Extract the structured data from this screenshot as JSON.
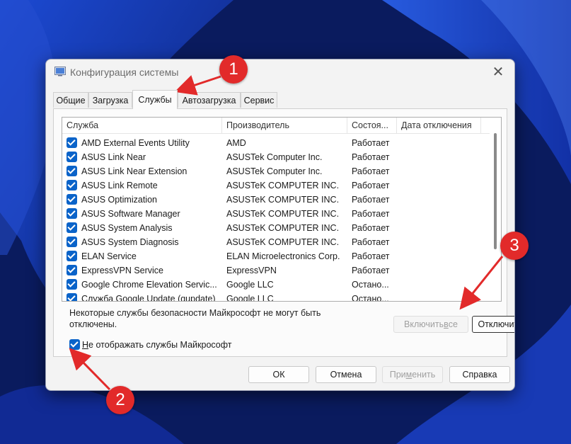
{
  "window": {
    "title": "Конфигурация системы",
    "close": "✕"
  },
  "tabs": [
    {
      "label": "Общие",
      "active": false
    },
    {
      "label": "Загрузка",
      "active": false
    },
    {
      "label": "Службы",
      "active": true
    },
    {
      "label": "Автозагрузка",
      "active": false
    },
    {
      "label": "Сервис",
      "active": false
    }
  ],
  "services_table": {
    "columns": [
      "Служба",
      "Производитель",
      "Состоя...",
      "Дата отключения"
    ],
    "rows": [
      {
        "checked": true,
        "service": "AMD External Events Utility",
        "manufacturer": "AMD",
        "status": "Работает",
        "disabled_date": ""
      },
      {
        "checked": true,
        "service": "ASUS Link Near",
        "manufacturer": "ASUSTek Computer Inc.",
        "status": "Работает",
        "disabled_date": ""
      },
      {
        "checked": true,
        "service": "ASUS Link Near Extension",
        "manufacturer": "ASUSTek Computer Inc.",
        "status": "Работает",
        "disabled_date": ""
      },
      {
        "checked": true,
        "service": "ASUS Link Remote",
        "manufacturer": "ASUSTeK COMPUTER INC.",
        "status": "Работает",
        "disabled_date": ""
      },
      {
        "checked": true,
        "service": "ASUS Optimization",
        "manufacturer": "ASUSTeK COMPUTER INC.",
        "status": "Работает",
        "disabled_date": ""
      },
      {
        "checked": true,
        "service": "ASUS Software Manager",
        "manufacturer": "ASUSTeK COMPUTER INC.",
        "status": "Работает",
        "disabled_date": ""
      },
      {
        "checked": true,
        "service": "ASUS System Analysis",
        "manufacturer": "ASUSTeK COMPUTER INC.",
        "status": "Работает",
        "disabled_date": ""
      },
      {
        "checked": true,
        "service": "ASUS System Diagnosis",
        "manufacturer": "ASUSTeK COMPUTER INC.",
        "status": "Работает",
        "disabled_date": ""
      },
      {
        "checked": true,
        "service": "ELAN Service",
        "manufacturer": "ELAN Microelectronics Corp.",
        "status": "Работает",
        "disabled_date": ""
      },
      {
        "checked": true,
        "service": "ExpressVPN Service",
        "manufacturer": "ExpressVPN",
        "status": "Работает",
        "disabled_date": ""
      },
      {
        "checked": true,
        "service": "Google Chrome Elevation Servic...",
        "manufacturer": "Google LLC",
        "status": "Остано...",
        "disabled_date": ""
      },
      {
        "checked": true,
        "service": "Служба Google Update (gupdate)",
        "manufacturer": "Google LLC",
        "status": "Остано...",
        "disabled_date": ""
      }
    ]
  },
  "note": {
    "line1": "Некоторые службы безопасности Майкрософт не могут быть",
    "line2": "отключены."
  },
  "buttons": {
    "enable_all": {
      "pre": "Включить ",
      "key": "в",
      "post": "се",
      "disabled": true
    },
    "disable_all": {
      "pre": "Отключить ",
      "key": "в",
      "post": "се",
      "disabled": false
    },
    "ok": "ОК",
    "cancel": "Отмена",
    "apply": {
      "pre": "При",
      "key": "м",
      "post": "енить",
      "disabled": true
    },
    "help": "Справка"
  },
  "hide_ms": {
    "checked": true,
    "key": "Н",
    "rest": "е отображать службы Майкрософт"
  },
  "callouts": [
    "1",
    "2",
    "3"
  ],
  "colors": {
    "accent": "#0a63c9",
    "callout": "#e22a2a",
    "wallpaper": "#0b1f6b"
  },
  "icons": {
    "app": "msconfig-icon",
    "close": "close-icon",
    "checkbox": "checkmark-icon"
  }
}
